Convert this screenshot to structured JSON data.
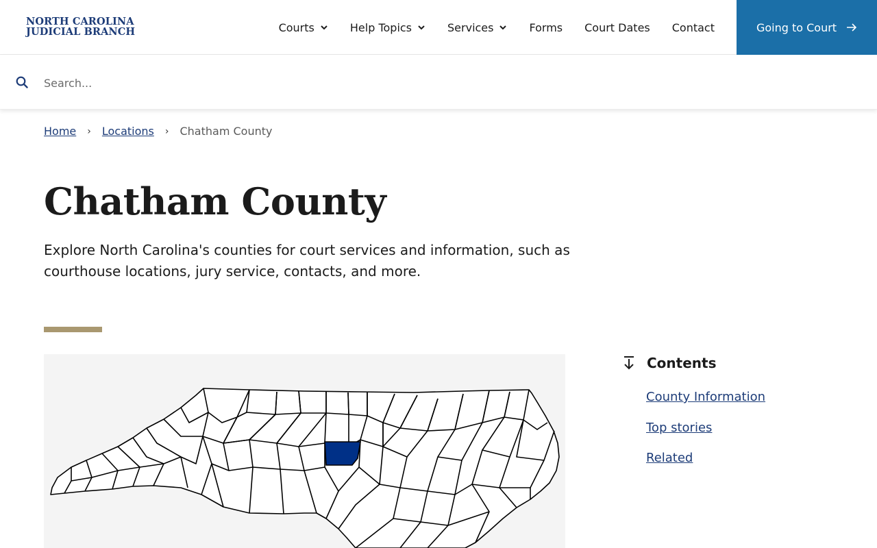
{
  "header": {
    "logo_line1": "NORTH CAROLINA",
    "logo_line2": "JUDICIAL BRANCH",
    "nav": [
      {
        "label": "Courts",
        "has_dropdown": true
      },
      {
        "label": "Help Topics",
        "has_dropdown": true
      },
      {
        "label": "Services",
        "has_dropdown": true
      },
      {
        "label": "Forms",
        "has_dropdown": false
      },
      {
        "label": "Court Dates",
        "has_dropdown": false
      },
      {
        "label": "Contact",
        "has_dropdown": false
      }
    ],
    "cta_label": "Going to Court",
    "cta_icon": "arrow-right-icon"
  },
  "search": {
    "placeholder": "Search...",
    "value": "",
    "icon": "search-icon"
  },
  "breadcrumb": {
    "items": [
      "Home",
      "Locations"
    ],
    "current": "Chatham County"
  },
  "page": {
    "title": "Chatham County",
    "intro": "Explore North Carolina's counties for court services and information, such as courthouse locations, jury service, contacts, and more."
  },
  "map": {
    "highlighted_county": "Chatham",
    "highlight_color": "#003087",
    "county_fill": "#ffffff",
    "border_color": "#000000",
    "background": "#f4f4f4"
  },
  "contents": {
    "title": "Contents",
    "icon": "arrow-down-to-line-icon",
    "items": [
      "County Information",
      "Top stories",
      "Related"
    ]
  },
  "colors": {
    "brand_navy": "#1d3c78",
    "cta_blue": "#1b6fa8",
    "accent_tan": "#a99870",
    "link": "#1d3c78"
  }
}
